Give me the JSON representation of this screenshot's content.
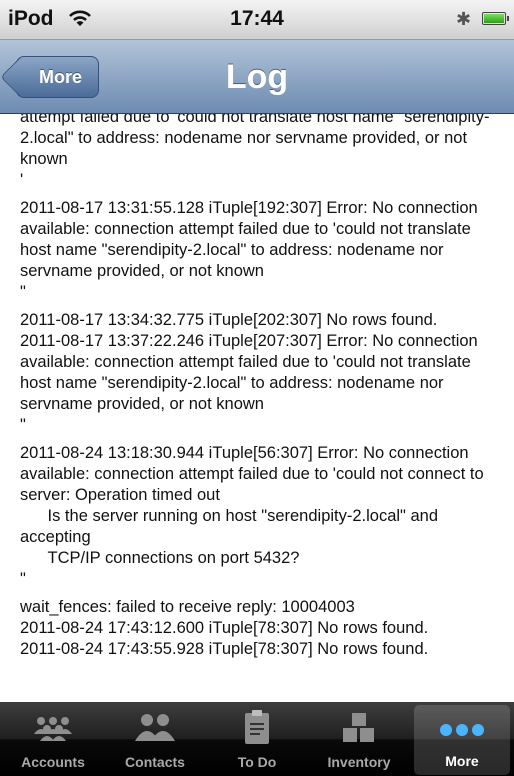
{
  "status_bar": {
    "carrier": "iPod",
    "time": "17:44"
  },
  "nav_bar": {
    "back_label": "More",
    "title": "Log"
  },
  "log_entries": [
    "attempt failed due to 'could not translate host name \"serendipity-2.local\" to address: nodename nor servname provided, or not known\n'",
    "2011-08-17 13:31:55.128 iTuple[192:307] Error: No connection available: connection attempt failed due to 'could not translate host name \"serendipity-2.local\" to address: nodename nor servname provided, or not known\n\"",
    "2011-08-17 13:34:32.775 iTuple[202:307] No rows found.\n2011-08-17 13:37:22.246 iTuple[207:307] Error: No connection available: connection attempt failed due to 'could not translate host name \"serendipity-2.local\" to address: nodename nor servname provided, or not known\n\"",
    "2011-08-24 13:18:30.944 iTuple[56:307] Error: No connection available: connection attempt failed due to 'could not connect to server: Operation timed out\n      Is the server running on host \"serendipity-2.local\" and accepting\n      TCP/IP connections on port 5432?\n\"",
    "wait_fences: failed to receive reply: 10004003\n2011-08-24 17:43:12.600 iTuple[78:307] No rows found.\n2011-08-24 17:43:55.928 iTuple[78:307] No rows found."
  ],
  "tab_bar": {
    "tabs": [
      {
        "label": "Accounts",
        "icon": "accounts-icon"
      },
      {
        "label": "Contacts",
        "icon": "contacts-icon"
      },
      {
        "label": "To Do",
        "icon": "todo-clipboard-icon"
      },
      {
        "label": "Inventory",
        "icon": "inventory-boxes-icon"
      },
      {
        "label": "More",
        "icon": "more-dots-icon",
        "selected": true
      }
    ]
  },
  "colors": {
    "nav_bar": "#6d8bb1",
    "tab_bar": "#000000",
    "selected_tab_icon": "#4ab5ff"
  }
}
